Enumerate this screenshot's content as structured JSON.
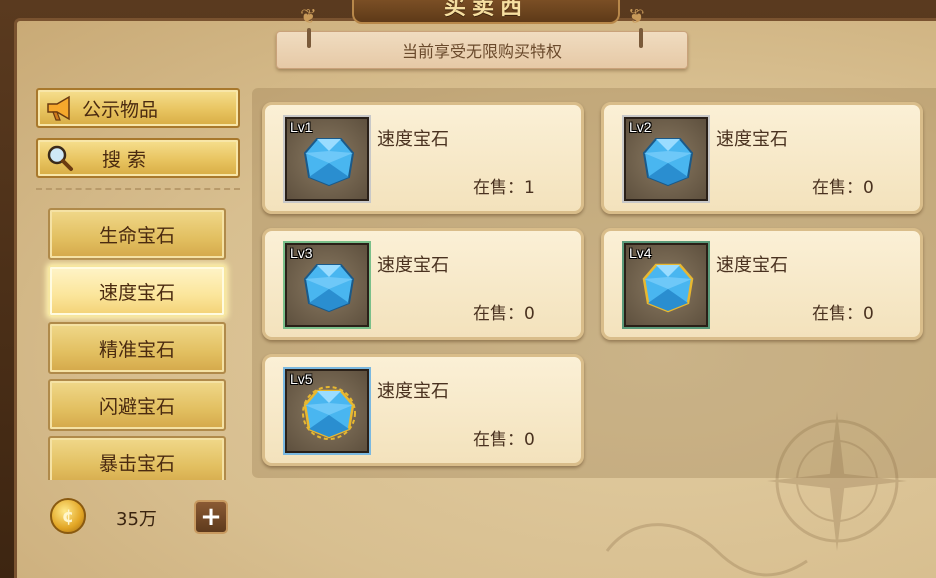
{
  "window": {
    "title": "买卖西"
  },
  "banner": {
    "text": "当前享受无限购买特权"
  },
  "sidebar": {
    "announce_label": "公示物品",
    "search_label": "搜 索",
    "categories": [
      {
        "label": "生命宝石",
        "selected": false
      },
      {
        "label": "速度宝石",
        "selected": true
      },
      {
        "label": "精准宝石",
        "selected": false
      },
      {
        "label": "闪避宝石",
        "selected": false
      },
      {
        "label": "暴击宝石",
        "selected": false
      }
    ]
  },
  "wallet": {
    "gold": "35万",
    "coin_symbol": "¢",
    "add_symbol": "+"
  },
  "items": [
    {
      "level": "Lv1",
      "name": "速度宝石",
      "stock": "在售：1",
      "quality": "q1"
    },
    {
      "level": "Lv2",
      "name": "速度宝石",
      "stock": "在售：0",
      "quality": "q1"
    },
    {
      "level": "Lv3",
      "name": "速度宝石",
      "stock": "在售：0",
      "quality": "q3"
    },
    {
      "level": "Lv4",
      "name": "速度宝石",
      "stock": "在售：0",
      "quality": "q4"
    },
    {
      "level": "Lv5",
      "name": "速度宝石",
      "stock": "在售：0",
      "quality": "q5"
    }
  ],
  "colors": {
    "gold_button": "#e8c460",
    "selected_button": "#fbe59a",
    "card_bg": "#fbf0d6",
    "text_brown": "#4a3220",
    "gem_blue": "#49b6f0"
  },
  "icons": [
    "megaphone-icon",
    "magnifier-icon",
    "coin-icon",
    "plus-icon",
    "gem-icon"
  ]
}
